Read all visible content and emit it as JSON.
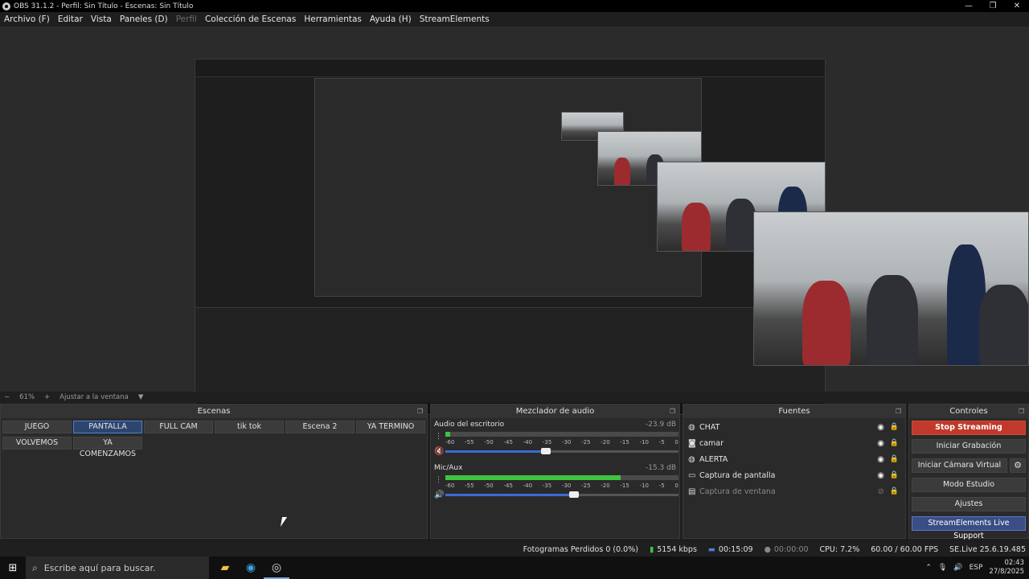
{
  "window": {
    "title": "OBS 31.1.2 - Perfil: Sin Título - Escenas: Sin Título",
    "controls": [
      "—",
      "❐",
      "✕"
    ]
  },
  "menu": [
    {
      "label": "Archivo (F)",
      "dim": false
    },
    {
      "label": "Editar",
      "dim": false
    },
    {
      "label": "Vista",
      "dim": false
    },
    {
      "label": "Paneles (D)",
      "dim": false
    },
    {
      "label": "Perfil",
      "dim": true
    },
    {
      "label": "Colección de Escenas",
      "dim": false
    },
    {
      "label": "Herramientas",
      "dim": false
    },
    {
      "label": "Ayuda (H)",
      "dim": false
    },
    {
      "label": "StreamElements",
      "dim": false
    }
  ],
  "zoom": {
    "minus": "−",
    "level": "61%",
    "plus": "+",
    "fit": "Ajustar a la ventana"
  },
  "scenes": {
    "title": "Escenas",
    "items": [
      {
        "label": "JUEGO",
        "active": false
      },
      {
        "label": "PANTALLA",
        "active": true
      },
      {
        "label": "FULL CAM",
        "active": false
      },
      {
        "label": "tik tok",
        "active": false
      },
      {
        "label": "Escena 2",
        "active": false
      },
      {
        "label": "YA TERMINO",
        "active": false
      },
      {
        "label": "VOLVEMOS",
        "active": false
      },
      {
        "label": "YA COMENZAMOS",
        "active": false
      }
    ]
  },
  "mixer": {
    "title": "Mezclador de audio",
    "ticks": [
      "-60",
      "-55",
      "-50",
      "-45",
      "-40",
      "-35",
      "-30",
      "-25",
      "-20",
      "-15",
      "-10",
      "-5",
      "0"
    ],
    "channels": [
      {
        "name": "Audio del escritorio",
        "db": "-23.9 dB",
        "level": 0.02,
        "volume": 0.43,
        "muted": true
      },
      {
        "name": "Mic/Aux",
        "db": "-15.3 dB",
        "level": 0.75,
        "volume": 0.55,
        "muted": false
      }
    ]
  },
  "sources": {
    "title": "Fuentes",
    "items": [
      {
        "name": "CHAT",
        "icon": "globe-icon",
        "visible": true
      },
      {
        "name": "camar",
        "icon": "camera-icon",
        "visible": true
      },
      {
        "name": "ALERTA",
        "icon": "globe-icon",
        "visible": true
      },
      {
        "name": "Captura de pantalla",
        "icon": "monitor-icon",
        "visible": true
      },
      {
        "name": "Captura de ventana",
        "icon": "window-icon",
        "visible": false
      }
    ]
  },
  "controls": {
    "title": "Controles",
    "stop_streaming": "Stop Streaming",
    "start_recording": "Iniciar Grabación",
    "virtual_camera": "Iniciar Cámara Virtual",
    "studio_mode": "Modo Estudio",
    "settings": "Ajustes",
    "se_support": "StreamElements Live Support"
  },
  "status": {
    "dropped_frames": "Fotogramas Perdidos 0 (0.0%)",
    "bitrate": "5154 kbps",
    "stream_time": "00:15:09",
    "record_time": "00:00:00",
    "cpu": "CPU: 7.2%",
    "fps": "60.00 / 60.00 FPS",
    "se_version": "SE.Live 25.6.19.485"
  },
  "taskbar": {
    "search_placeholder": "Escribe aquí para buscar.",
    "lang": "ESP",
    "time": "02:43",
    "date": "27/8/2025"
  },
  "colors": {
    "stop_button": "#c0392b",
    "active_scene": "#2d4670",
    "meter_green": "#3fc43f",
    "volume_fill": "#3d6ad6",
    "se_button": "#3a4e85"
  }
}
